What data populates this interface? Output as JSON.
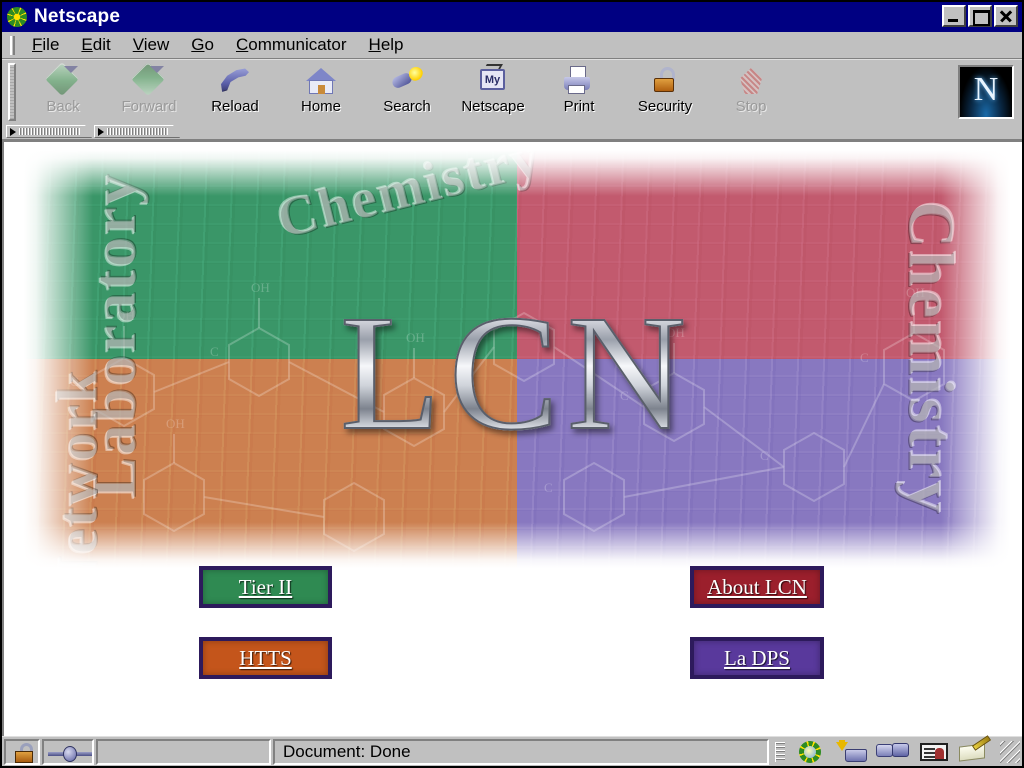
{
  "window": {
    "title": "Netscape",
    "icon": "netscape-star-icon",
    "controls": {
      "minimize": "Minimize",
      "maximize": "Maximize",
      "close": "Close"
    }
  },
  "menubar": {
    "items": [
      {
        "label": "File",
        "accel": "F"
      },
      {
        "label": "Edit",
        "accel": "E"
      },
      {
        "label": "View",
        "accel": "V"
      },
      {
        "label": "Go",
        "accel": "G"
      },
      {
        "label": "Communicator",
        "accel": "C"
      },
      {
        "label": "Help",
        "accel": "H"
      }
    ]
  },
  "toolbar": {
    "buttons": [
      {
        "label": "Back",
        "icon": "back-arrow-icon",
        "enabled": false
      },
      {
        "label": "Forward",
        "icon": "forward-arrow-icon",
        "enabled": false
      },
      {
        "label": "Reload",
        "icon": "reload-icon",
        "enabled": true
      },
      {
        "label": "Home",
        "icon": "home-icon",
        "enabled": true
      },
      {
        "label": "Search",
        "icon": "search-flashlight-icon",
        "enabled": true
      },
      {
        "label": "Netscape",
        "icon": "my-netscape-icon",
        "enabled": true
      },
      {
        "label": "Print",
        "icon": "printer-icon",
        "enabled": true
      },
      {
        "label": "Security",
        "icon": "padlock-icon",
        "enabled": true
      },
      {
        "label": "Stop",
        "icon": "stop-sign-icon",
        "enabled": false
      }
    ],
    "logo": {
      "letter": "N",
      "name": "netscape-logo"
    }
  },
  "collapsed_toolbars": [
    {
      "name": "location-toolbar-tab"
    },
    {
      "name": "personal-toolbar-tab"
    }
  ],
  "page": {
    "banner": {
      "wordmark": "LCN",
      "vertical_words": {
        "left_top": "Laboratory",
        "left_bottom": "Network",
        "right": "Chemistry",
        "top": "Chemistry"
      },
      "quadrant_colors": {
        "top_left": "#3a9668",
        "top_right": "#c25a6e",
        "bottom_left": "#cc8050",
        "bottom_right": "#8878c0"
      }
    },
    "links": [
      {
        "label": "Tier II",
        "bg": "#2f8a52",
        "border": "#2d1a5c"
      },
      {
        "label": "HTTS",
        "bg": "#c4551b",
        "border": "#2d1a5c"
      },
      {
        "label": "About LCN",
        "bg": "#9b1f2c",
        "border": "#2d1a5c"
      },
      {
        "label": "La DPS",
        "bg": "#59399c",
        "border": "#2d1a5c"
      }
    ]
  },
  "statusbar": {
    "security_icon": "unlocked-padlock-icon",
    "connection_icon": "network-connection-icon",
    "message": "Document: Done",
    "components": [
      {
        "name": "navigator-icon",
        "label": "Navigator"
      },
      {
        "name": "mailbox-icon",
        "label": "Mailbox"
      },
      {
        "name": "discussions-icon",
        "label": "Discussions"
      },
      {
        "name": "address-book-icon",
        "label": "Address Book"
      },
      {
        "name": "composer-icon",
        "label": "Composer"
      }
    ]
  }
}
